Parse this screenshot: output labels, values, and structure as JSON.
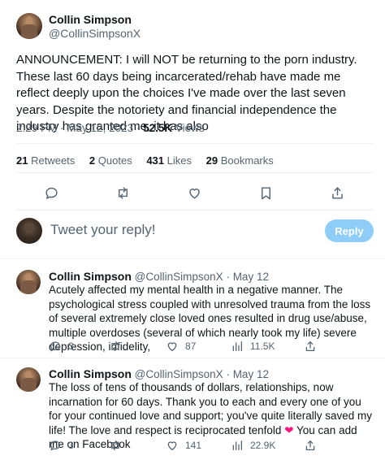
{
  "tweet": {
    "author_name": "Collin Simpson",
    "author_handle": "@CollinSimpsonX",
    "text": "ANNOUNCEMENT: I will NOT be returning to the porn industry. These last 60 days being incarcerated/rehab have made me reflect deeply upon the choices I've made over the last seven years. Despite the notoriety and financial independence the industry has granted me, it has also",
    "time": "2:29 PM",
    "date": "May 12, 2023",
    "views_count": "52.5K",
    "views_label": "Views",
    "stats": {
      "retweets_count": "21",
      "retweets_label": "Retweets",
      "quotes_count": "2",
      "quotes_label": "Quotes",
      "likes_count": "431",
      "likes_label": "Likes",
      "bookmarks_count": "29",
      "bookmarks_label": "Bookmarks"
    },
    "actions": [
      "reply-icon",
      "retweet-icon",
      "like-icon",
      "bookmark-icon",
      "share-icon"
    ]
  },
  "composer": {
    "placeholder": "Tweet your reply!",
    "button_label": "Reply",
    "button_color": "#8ecdf8"
  },
  "replies": [
    {
      "author_name": "Collin Simpson",
      "author_handle": "@CollinSimpsonX",
      "date": "May 12",
      "text": "Acutely affected my mental health in a negative manner. The psychological stress coupled with unresolved trauma from the loss of several extremely close loved ones resulted in drug use/abuse, multiple overdoses (several of which nearly took my life) severe depression, infidelity,",
      "replies_count": "3",
      "retweets_count": "",
      "likes_count": "87",
      "views_count": "11.5K"
    },
    {
      "author_name": "Collin Simpson",
      "author_handle": "@CollinSimpsonX",
      "date": "May 12",
      "text_before_heart": "The loss of tens of thousands of dollars, relationships, now incarnation for 60 days. Thank you to each and every one of you for your continued love and support; you've quite literally saved my life! The love and respect is reciprocated tenfold",
      "text_after_heart": "You can add me on Facebook",
      "replies_count": "3",
      "retweets_count": "",
      "likes_count": "141",
      "views_count": "22.9K"
    }
  ],
  "colors": {
    "text": "#0f1419",
    "secondary": "#536471",
    "divider": "#eff3f4",
    "heart": "#f91880"
  }
}
